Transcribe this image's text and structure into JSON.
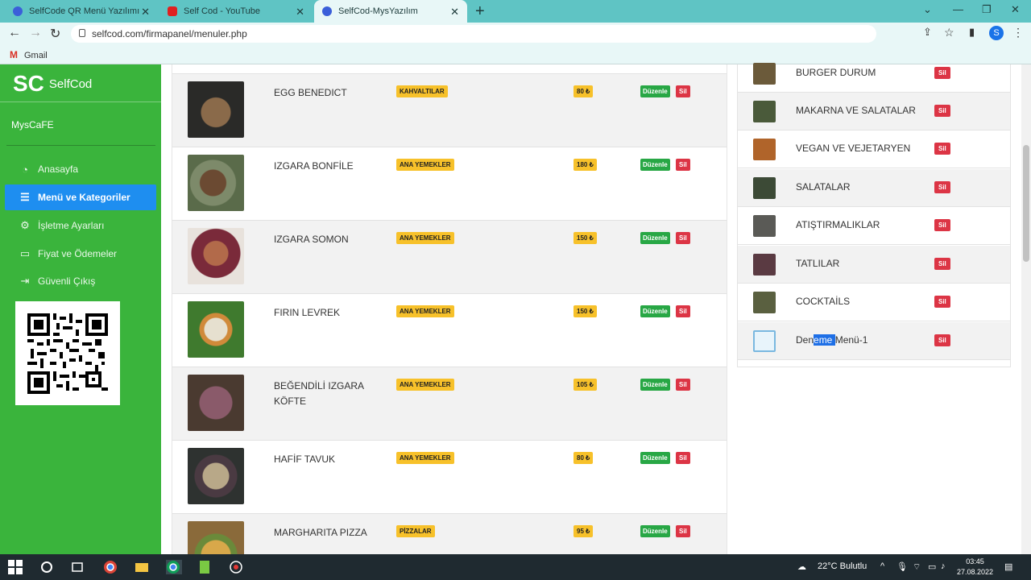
{
  "browser": {
    "tabs": [
      {
        "title": "SelfCode QR Menü Yazılımı"
      },
      {
        "title": "Self Cod - YouTube"
      },
      {
        "title": "SelfCod-MysYazılım"
      }
    ],
    "url": "selfcod.com/firmapanel/menuler.php",
    "bookmark": "Gmail",
    "profile_initial": "S"
  },
  "sidebar": {
    "logo_mark": "SC",
    "logo_name": "SelfCod",
    "cafe_name": "MysCaFE",
    "items": [
      {
        "label": "Anasayfa",
        "icon": "dashboard-icon"
      },
      {
        "label": "Menü ve Kategoriler",
        "icon": "menu-list-icon"
      },
      {
        "label": "İşletme Ayarları",
        "icon": "gears-icon"
      },
      {
        "label": "Fiyat ve Ödemeler",
        "icon": "money-icon"
      },
      {
        "label": "Güvenli Çıkış",
        "icon": "logout-icon"
      }
    ]
  },
  "products": [
    {
      "name": "EGG BENEDICT",
      "category": "KAHVALTILAR",
      "price": "80 ₺",
      "color": "#3a3a38"
    },
    {
      "name": "IZGARA BONFİLE",
      "category": "ANA YEMEKLER",
      "price": "180 ₺",
      "color": "#5a6b4a"
    },
    {
      "name": "IZGARA SOMON",
      "category": "ANA YEMEKLER",
      "price": "150 ₺",
      "color": "#8a3b3b"
    },
    {
      "name": "FIRIN LEVREK",
      "category": "ANA YEMEKLER",
      "price": "150 ₺",
      "color": "#4f7a3a"
    },
    {
      "name": "BEĞENDİLİ IZGARA KÖFTE",
      "category": "ANA YEMEKLER",
      "price": "105 ₺",
      "color": "#6b4a55"
    },
    {
      "name": "HAFİF TAVUK",
      "category": "ANA YEMEKLER",
      "price": "80 ₺",
      "color": "#3d4642"
    },
    {
      "name": "MARGHARITA PIZZA",
      "category": "PİZZALAR",
      "price": "95 ₺",
      "color": "#8a6a3a"
    }
  ],
  "product_actions": {
    "edit": "Düzenle",
    "delete": "Sil"
  },
  "categories": [
    {
      "name": "BURGER DURUM",
      "color": "#6b5a3a"
    },
    {
      "name": "MAKARNA VE SALATALAR",
      "color": "#4a5a3a"
    },
    {
      "name": "VEGAN VE VEJETARYEN",
      "color": "#b0642a"
    },
    {
      "name": "SALATALAR",
      "color": "#3c4a36"
    },
    {
      "name": "ATIŞTIRMALIKLAR",
      "color": "#5a5a56"
    },
    {
      "name": "TATLILAR",
      "color": "#5a3a42"
    },
    {
      "name": "COCKTAİLS",
      "color": "#5a6040"
    },
    {
      "name_pre": "Den",
      "name_hl": "eme ",
      "name_post": "Menü-1",
      "color": "#7ab8e0"
    }
  ],
  "category_delete": "Sil",
  "taskbar": {
    "weather": "22°C  Bulutlu",
    "time": "03:45",
    "date": "27.08.2022"
  }
}
